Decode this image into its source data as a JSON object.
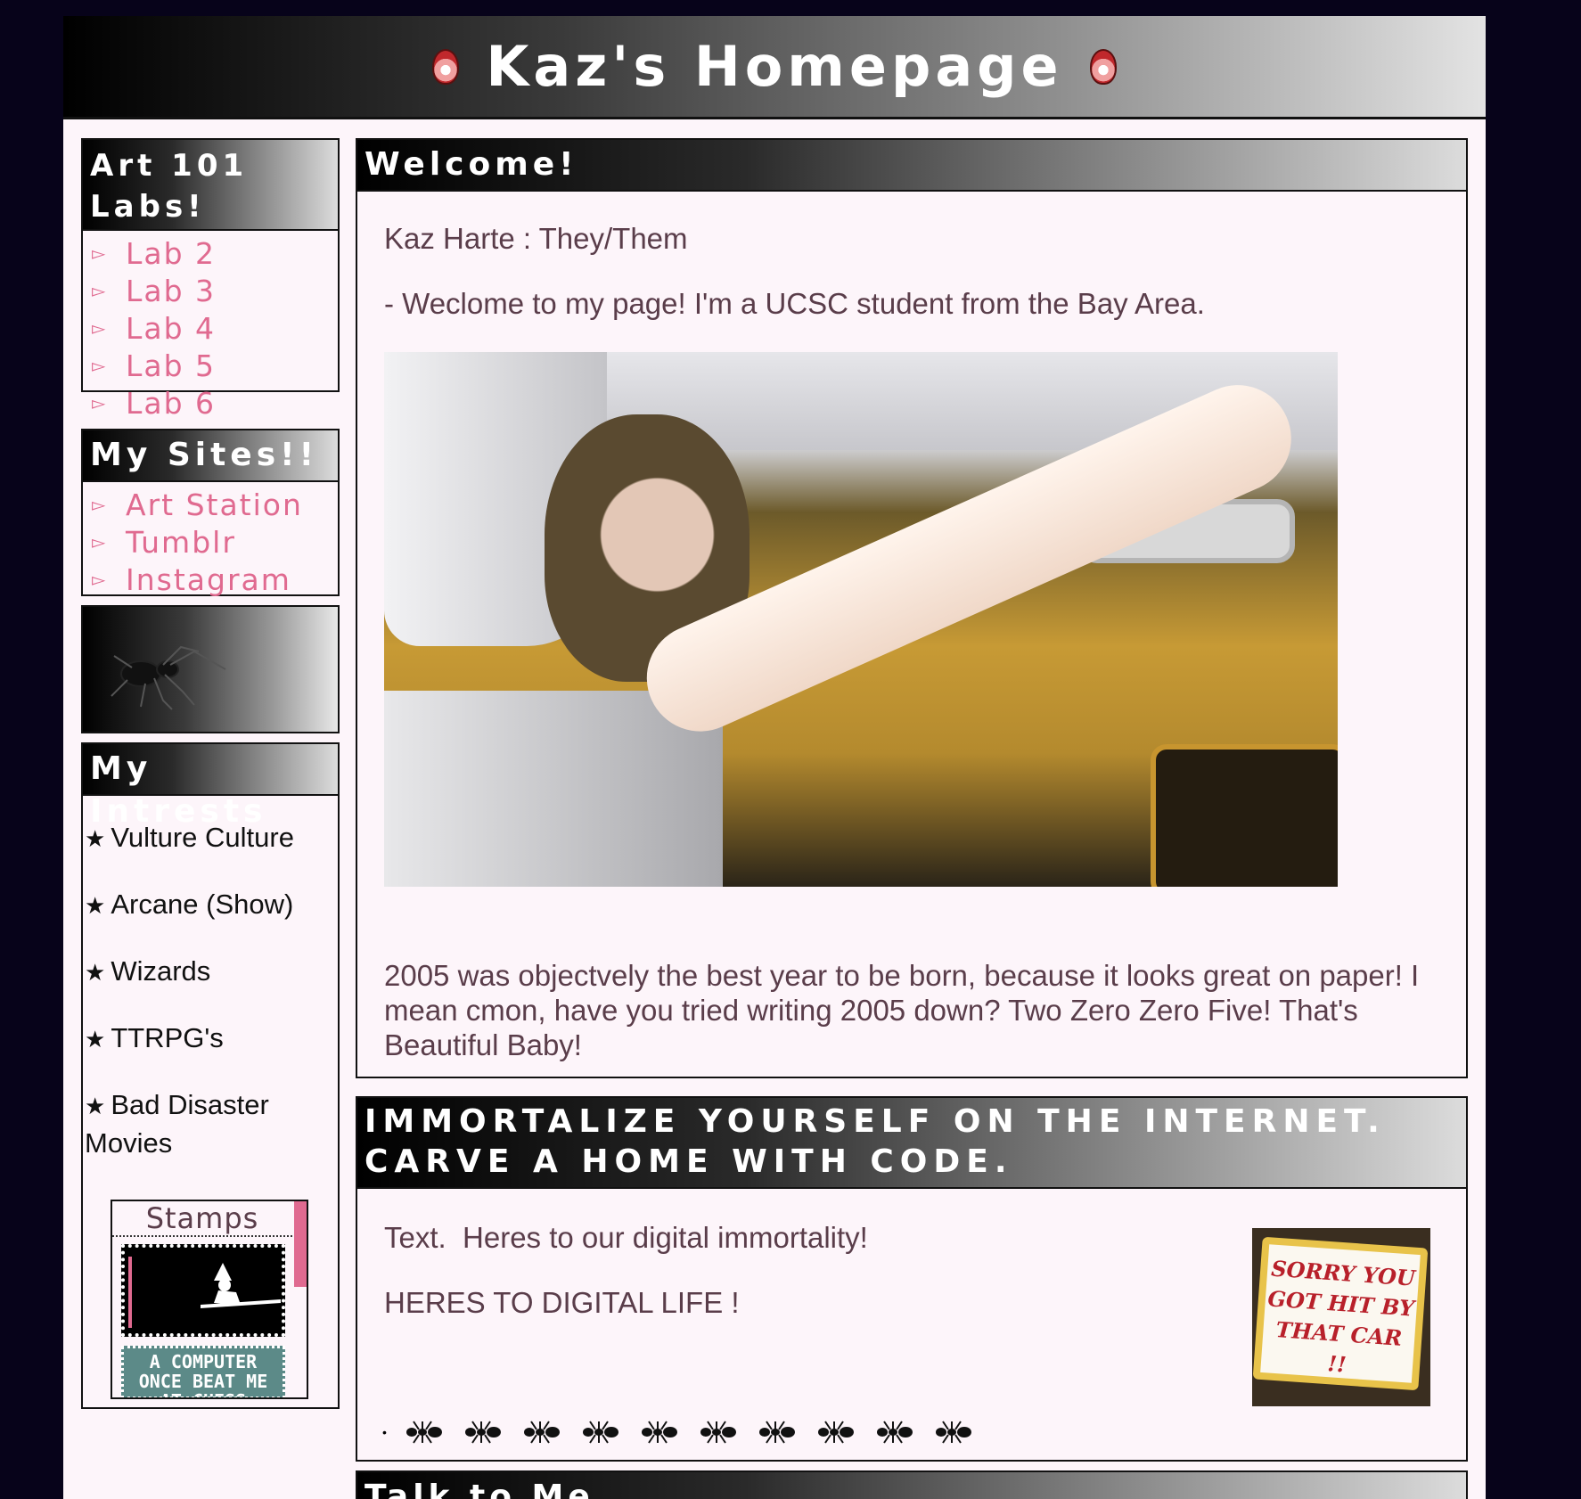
{
  "header": {
    "title": "Kaz's Homepage",
    "left_icon": "flaming-heart-icon",
    "right_icon": "flaming-heart-icon"
  },
  "sidebar": {
    "labs": {
      "title": "Art 101 Labs!",
      "items": [
        {
          "label": "Lab 2"
        },
        {
          "label": "Lab 3"
        },
        {
          "label": "Lab 4"
        },
        {
          "label": "Lab 5"
        },
        {
          "label": "Lab 6"
        }
      ]
    },
    "sites": {
      "title": "My Sites!!",
      "items": [
        {
          "label": "Art Station"
        },
        {
          "label": "Tumblr"
        },
        {
          "label": "Instagram"
        }
      ]
    },
    "spider_banner_icon": "spider-icon",
    "interests": {
      "title": "My Intrests",
      "star": "★",
      "items": [
        {
          "label": "Vulture Culture"
        },
        {
          "label": "Arcane (Show)"
        },
        {
          "label": "Wizards"
        },
        {
          "label": "TTRPG's"
        },
        {
          "label": "Bad Disaster Movies"
        }
      ]
    },
    "stamps": {
      "title": "Stamps",
      "stamp2_text": "A COMPUTER ONCE BEAT ME AT CHESS"
    }
  },
  "welcome": {
    "title": "Welcome!",
    "name_line": "Kaz Harte : They/Them",
    "intro": "- Weclome to my page! I'm a UCSC student from the Bay Area.",
    "paragraph": "2005 was objectvely the best year to be born, because it looks great on paper! I mean cmon, have you tried writing 2005 down? Two Zero Zero Five! That's Beautiful Baby!"
  },
  "immortalize": {
    "title": "IMMORTALIZE YOURSELF ON THE INTERNET. CARVE A HOME WITH CODE.",
    "text1": "Text.  Heres to our digital immortality!",
    "text2": "HERES TO DIGITAL LIFE !",
    "cake_text": "SORRY YOU GOT HIT BY THAT CAR !!"
  },
  "talk": {
    "title": "Talk to Me"
  },
  "colors": {
    "link": "#e06a90",
    "background": "#07031a",
    "panel": "#fdf5fa",
    "body_text": "#5a3d4a"
  }
}
